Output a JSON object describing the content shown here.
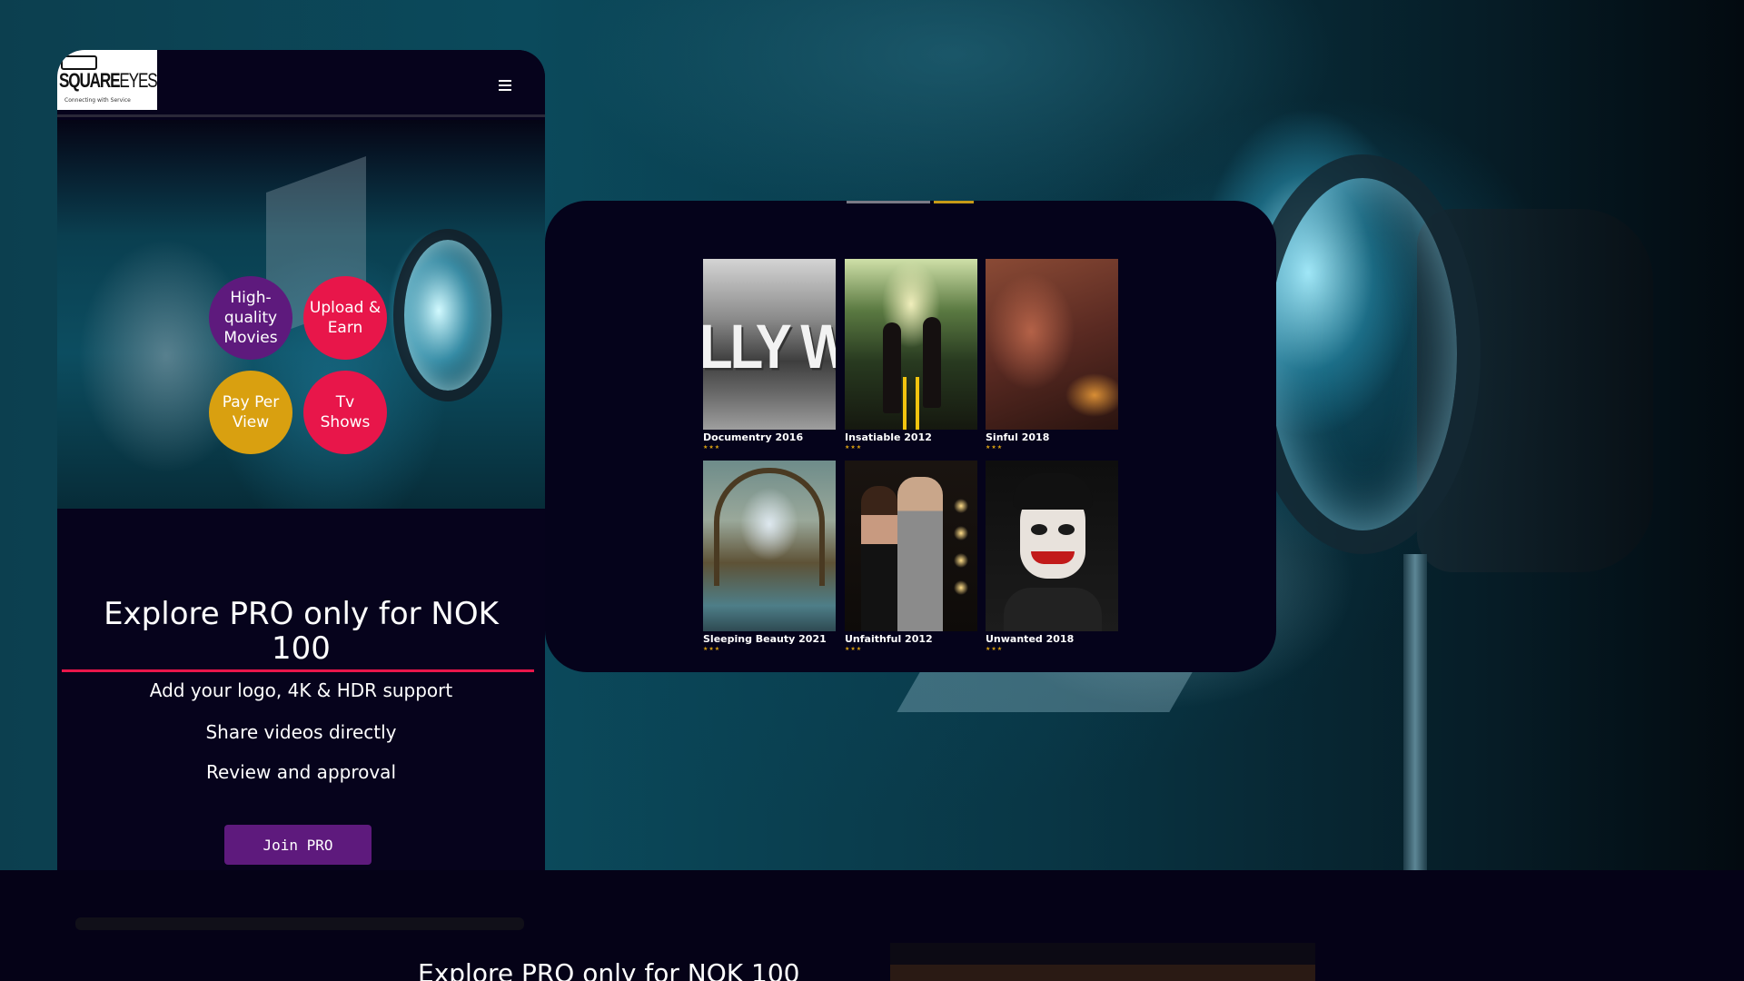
{
  "brand": {
    "logo_text_bold": "SQUARE",
    "logo_text_light": "EYES",
    "logo_tagline": "Connecting with Service"
  },
  "colors": {
    "background": "#050215",
    "accent_red": "#e8164a",
    "accent_purple": "#5e1a7d",
    "accent_gold": "#d9a010"
  },
  "header": {
    "menu_icon": "hamburger-menu-icon"
  },
  "features": [
    {
      "label": "High-quality Movies",
      "color": "#5e1a7d"
    },
    {
      "label": "Upload & Earn",
      "color": "#e8164a"
    },
    {
      "label": "Pay Per View",
      "color": "#d9a010"
    },
    {
      "label": "Tv Shows",
      "color": "#e8164a"
    }
  ],
  "promo": {
    "title": "Explore PRO only for NOK 100",
    "lines": [
      "Add your logo, 4K & HDR support",
      "Share videos directly",
      "Review and approval"
    ],
    "join_label": "Join PRO"
  },
  "movies": [
    {
      "title": "Documentry 2016",
      "stars": "★★★",
      "rating": 3
    },
    {
      "title": "Insatiable 2012",
      "stars": "★★★",
      "rating": 3
    },
    {
      "title": "Sinful 2018",
      "stars": "★★★",
      "rating": 3
    },
    {
      "title": "Sleeping Beauty 2021",
      "stars": "★★★",
      "rating": 3
    },
    {
      "title": "Unfaithful 2012",
      "stars": "★★★",
      "rating": 3
    },
    {
      "title": "Unwanted 2018",
      "stars": "★★★",
      "rating": 3
    }
  ],
  "poster_text": {
    "documentry_sign": "LLY W"
  },
  "bottom": {
    "title": "Explore PRO only for NOK 100"
  }
}
